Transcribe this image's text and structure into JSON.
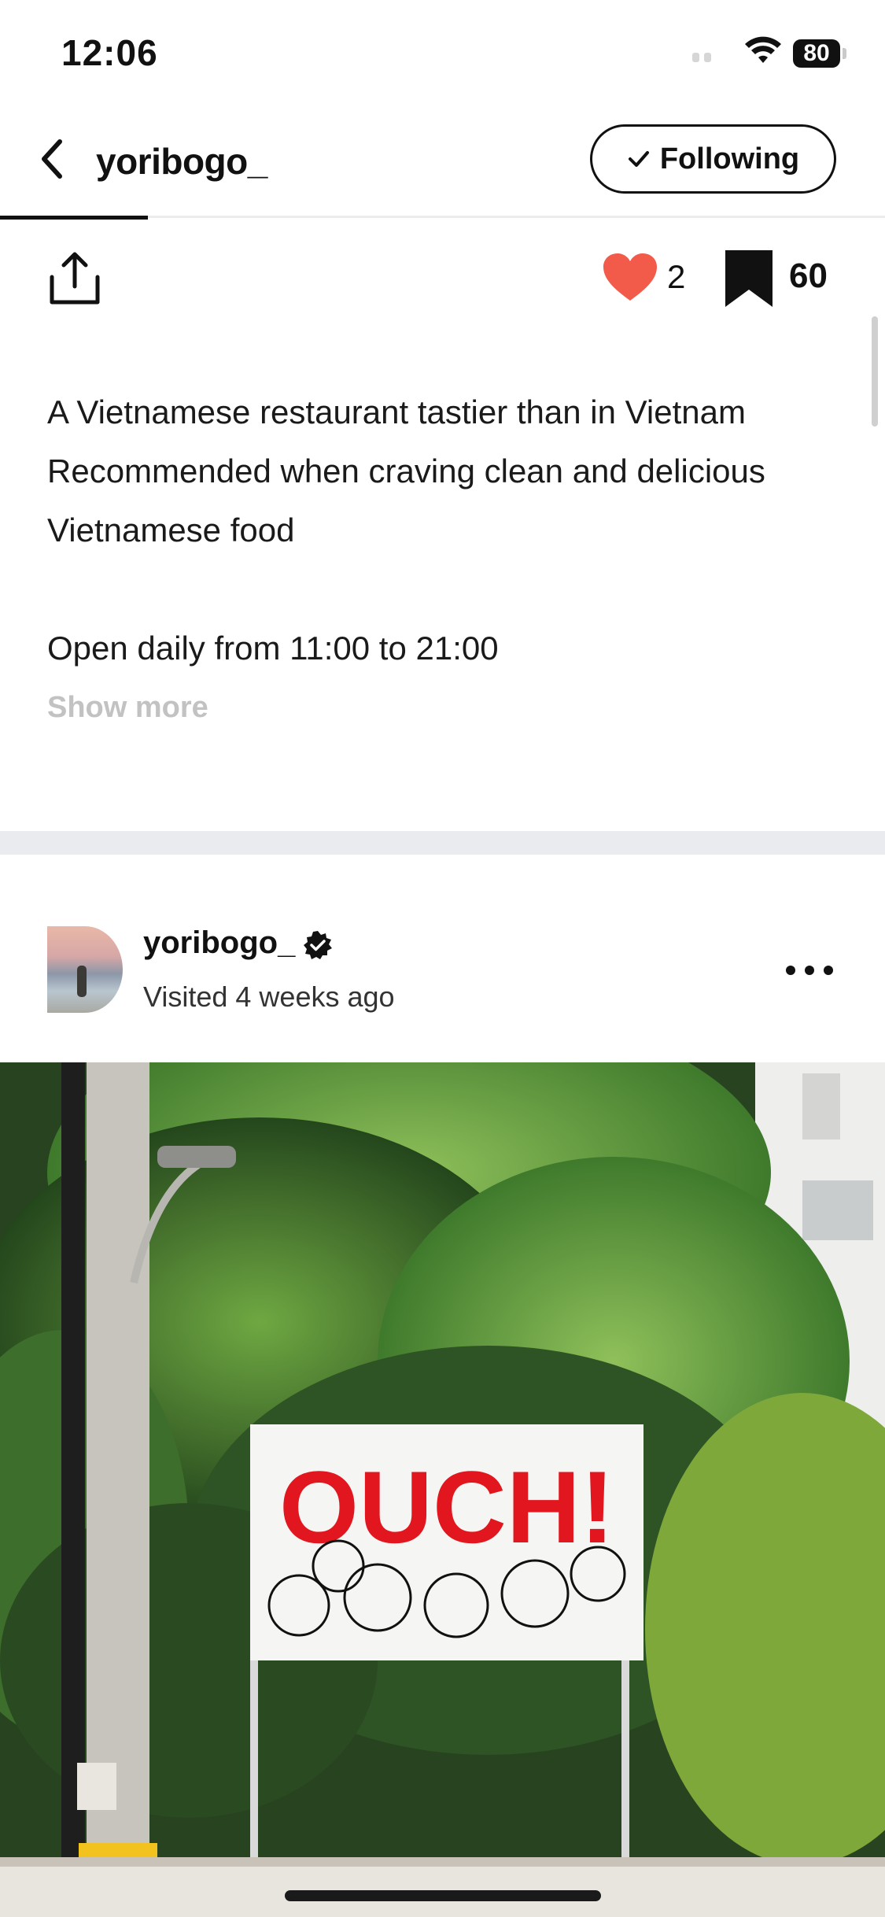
{
  "status_bar": {
    "time": "12:06",
    "battery": "80"
  },
  "header": {
    "title": "yoribogo_",
    "follow_label": "Following"
  },
  "actions": {
    "like_count": "2",
    "save_count": "60"
  },
  "description": {
    "lines": [
      "A Vietnamese restaurant tastier than in Vietnam",
      "Recommended when craving clean and delicious",
      "Vietnamese food"
    ],
    "hours": "Open daily from 11:00 to 21:00",
    "show_more": "Show more"
  },
  "post": {
    "username": "yoribogo_",
    "meta": "Visited 4 weeks ago",
    "photo": {
      "sign_text": "OUCH!"
    }
  },
  "colors": {
    "like": "#f25a4a",
    "accent": "#111111",
    "sign_text": "#e2161e"
  }
}
